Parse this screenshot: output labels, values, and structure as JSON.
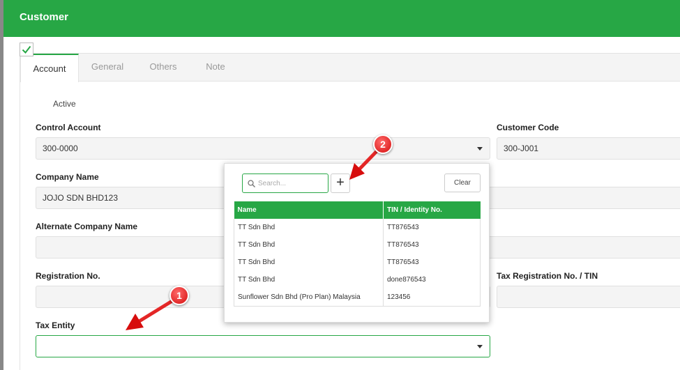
{
  "header": {
    "title": "Customer"
  },
  "tabs": [
    {
      "label": "Account"
    },
    {
      "label": "General"
    },
    {
      "label": "Others"
    },
    {
      "label": "Note"
    }
  ],
  "form": {
    "active_label": "Active",
    "control_account_label": "Control Account",
    "control_account_value": "300-0000",
    "customer_code_label": "Customer Code",
    "customer_code_value": "300-J001",
    "company_name_label": "Company Name",
    "company_name_value": "JOJO SDN BHD123",
    "alt_company_name_label": "Alternate Company Name",
    "registration_label": "Registration No.",
    "tax_registration_label": "Tax Registration No. / TIN",
    "tax_entity_label": "Tax Entity"
  },
  "popup": {
    "search_placeholder": "Search...",
    "add_label": "+",
    "clear_label": "Clear",
    "columns": [
      "Name",
      "TIN / Identity No."
    ],
    "rows": [
      [
        "TT Sdn Bhd",
        "TT876543"
      ],
      [
        "TT Sdn Bhd",
        "TT876543"
      ],
      [
        "TT Sdn Bhd",
        "TT876543"
      ],
      [
        "TT Sdn Bhd",
        "done876543"
      ],
      [
        "Sunflower Sdn Bhd (Pro Plan) Malaysia",
        "123456"
      ]
    ]
  },
  "annotations": [
    {
      "number": "1"
    },
    {
      "number": "2"
    }
  ],
  "colors": {
    "brand": "#27a745",
    "marker": "#e01b1b"
  }
}
